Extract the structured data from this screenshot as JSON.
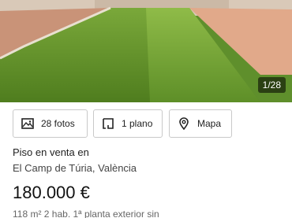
{
  "listing": {
    "photo_counter": "1/28",
    "buttons": {
      "photos": "28 fotos",
      "plans": "1 plano",
      "map": "Mapa"
    },
    "title_line1": "Piso en venta en",
    "title_line2": "El Camp de Túria, València",
    "price": "180.000 €",
    "details": "118 m²   2 hab.   1ª planta exterior sin"
  },
  "icons": {
    "photos": "image-icon",
    "plans": "floorplan-icon",
    "map": "location-pin-icon"
  },
  "colors": {
    "grass": "#5f8f2c",
    "terrace_tile": "#e1a98a",
    "counter_bg": "#000000"
  }
}
